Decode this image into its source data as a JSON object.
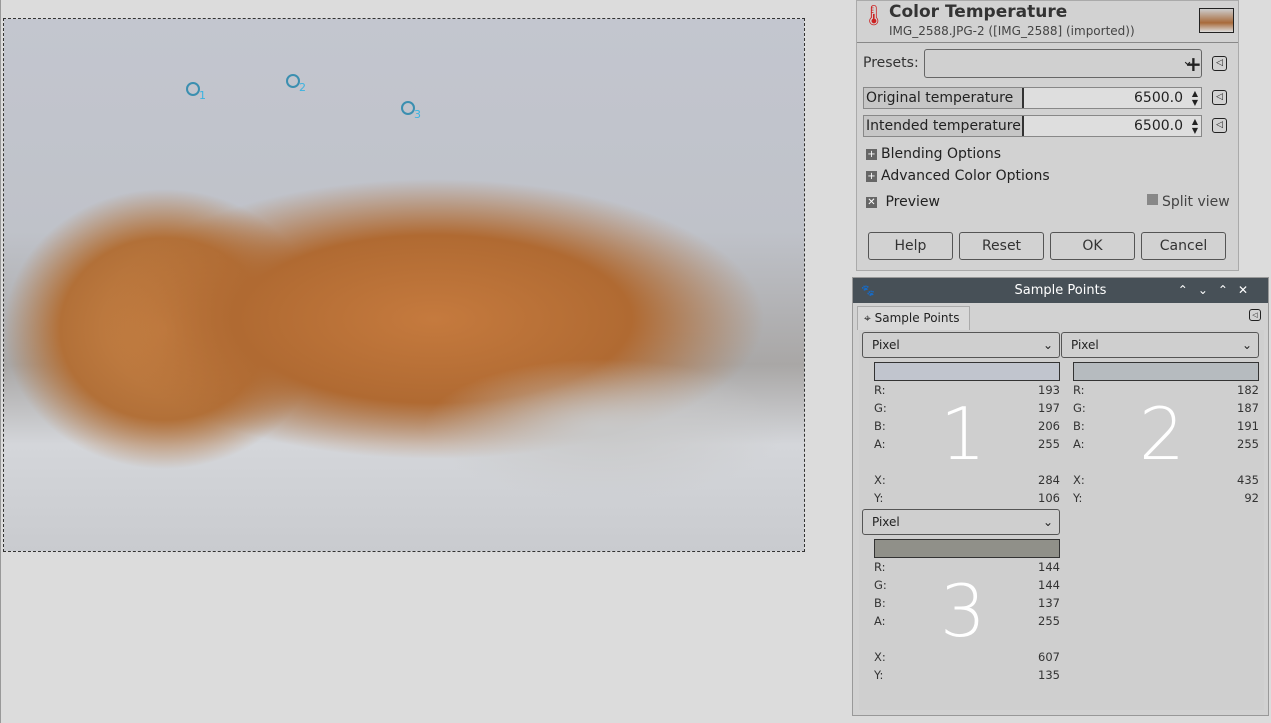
{
  "canvas": {
    "sample_points": [
      {
        "num": "1"
      },
      {
        "num": "2"
      },
      {
        "num": "3"
      }
    ]
  },
  "dialog": {
    "title": "Color Temperature",
    "subtitle": "IMG_2588.JPG-2 ([IMG_2588] (imported))",
    "presets_label": "Presets:",
    "presets_value": "",
    "original_label": "Original temperature",
    "original_value": "6500.0",
    "intended_label": "Intended temperature",
    "intended_value": "6500.0",
    "blending": "Blending Options",
    "advanced": "Advanced Color Options",
    "preview": "Preview",
    "split_view": "Split view",
    "buttons": {
      "help": "Help",
      "reset": "Reset",
      "ok": "OK",
      "cancel": "Cancel"
    }
  },
  "sample_panel": {
    "title": "Sample Points",
    "tab": "Sample Points",
    "points": [
      {
        "num": "1",
        "mode": "Pixel",
        "color": "#c1c5ce",
        "R": "193",
        "G": "197",
        "B": "206",
        "A": "255",
        "X": "284",
        "Y": "106"
      },
      {
        "num": "2",
        "mode": "Pixel",
        "color": "#b6bbbf",
        "R": "182",
        "G": "187",
        "B": "191",
        "A": "255",
        "X": "435",
        "Y": "92"
      },
      {
        "num": "3",
        "mode": "Pixel",
        "color": "#909089",
        "R": "144",
        "G": "144",
        "B": "137",
        "A": "255",
        "X": "607",
        "Y": "135"
      }
    ],
    "labels": {
      "R": "R:",
      "G": "G:",
      "B": "B:",
      "A": "A:",
      "X": "X:",
      "Y": "Y:"
    }
  }
}
